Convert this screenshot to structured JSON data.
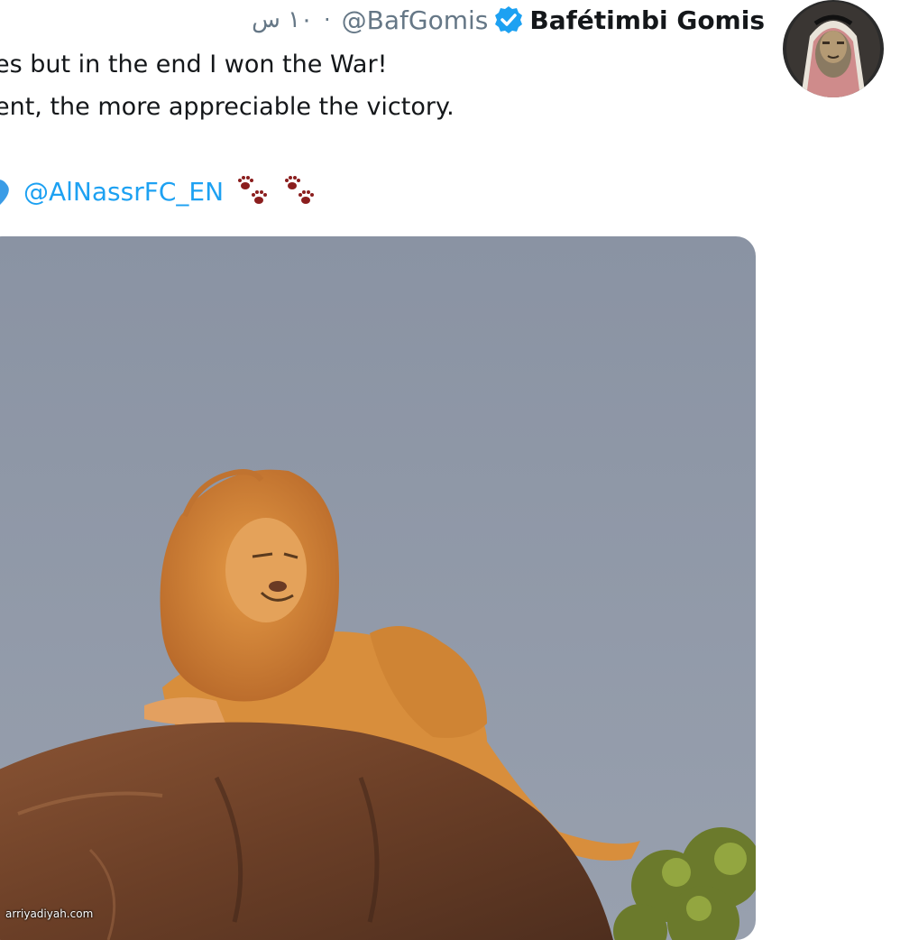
{
  "tweet": {
    "display_name": "Bafétimbi Gomis",
    "handle": "@BafGomis",
    "separator": "·",
    "time": "١٠ س",
    "text_line_1": "es but in the end I won the War!",
    "text_line_2": "ent, the more appreciable the victory.",
    "mention": "@AlNassrFC_EN",
    "icons": {
      "verified": "verified-badge-icon",
      "heart": "blue-heart-emoji",
      "paws": [
        "paw-prints-emoji",
        "paw-prints-emoji"
      ]
    }
  },
  "media": {
    "description_icon": "lion-on-rock-video-thumbnail"
  },
  "watermark": "arriyadiyah.com",
  "colors": {
    "link": "#1da1f2",
    "secondary_text": "#657786",
    "primary_text": "#14171a",
    "sky": "#8d96a6",
    "lion": "#d08a3a",
    "rock": "#6b4028"
  }
}
